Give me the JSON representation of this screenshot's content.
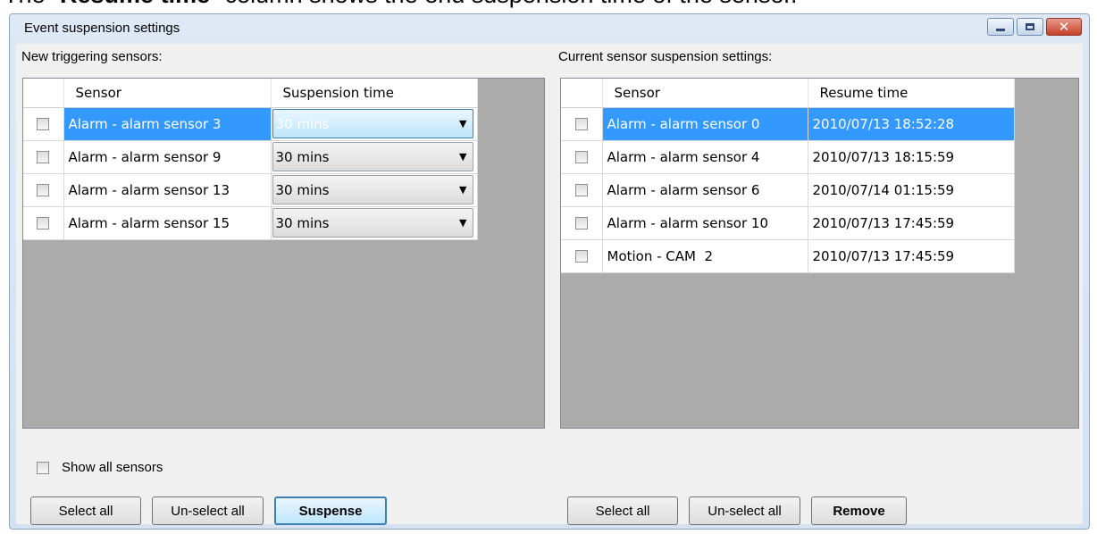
{
  "caption": {
    "prefix": "The “",
    "bold": "Resume time",
    "suffix": "” column shows the end suspension time of the sensor."
  },
  "window": {
    "title": "Event suspension settings"
  },
  "left": {
    "heading": "New triggering sensors:",
    "columns": [
      "Sensor",
      "Suspension time"
    ],
    "rows": [
      {
        "sensor": "Alarm - alarm sensor 3",
        "time": "30 mins",
        "selected": true
      },
      {
        "sensor": "Alarm - alarm sensor 9",
        "time": "30 mins",
        "selected": false
      },
      {
        "sensor": "Alarm - alarm sensor 13",
        "time": "30 mins",
        "selected": false
      },
      {
        "sensor": "Alarm - alarm sensor 15",
        "time": "30 mins",
        "selected": false
      }
    ],
    "show_all_label": "Show all sensors",
    "select_all": "Select all",
    "unselect_all": "Un-select all",
    "action": "Suspense"
  },
  "right": {
    "heading": "Current sensor suspension settings:",
    "columns": [
      "Sensor",
      "Resume time"
    ],
    "rows": [
      {
        "sensor": "Alarm - alarm sensor 0",
        "resume": "2010/07/13 18:52:28",
        "selected": true
      },
      {
        "sensor": "Alarm - alarm sensor 4",
        "resume": "2010/07/13 18:15:59",
        "selected": false
      },
      {
        "sensor": "Alarm - alarm sensor 6",
        "resume": "2010/07/14 01:15:59",
        "selected": false
      },
      {
        "sensor": "Alarm - alarm sensor 10",
        "resume": "2010/07/13 17:45:59",
        "selected": false
      },
      {
        "sensor": "Motion - CAM  2",
        "resume": "2010/07/13 17:45:59",
        "selected": false
      }
    ],
    "select_all": "Select all",
    "unselect_all": "Un-select all",
    "action": "Remove"
  },
  "colors": {
    "selection": "#3399ff",
    "grid_background": "#ababab"
  }
}
